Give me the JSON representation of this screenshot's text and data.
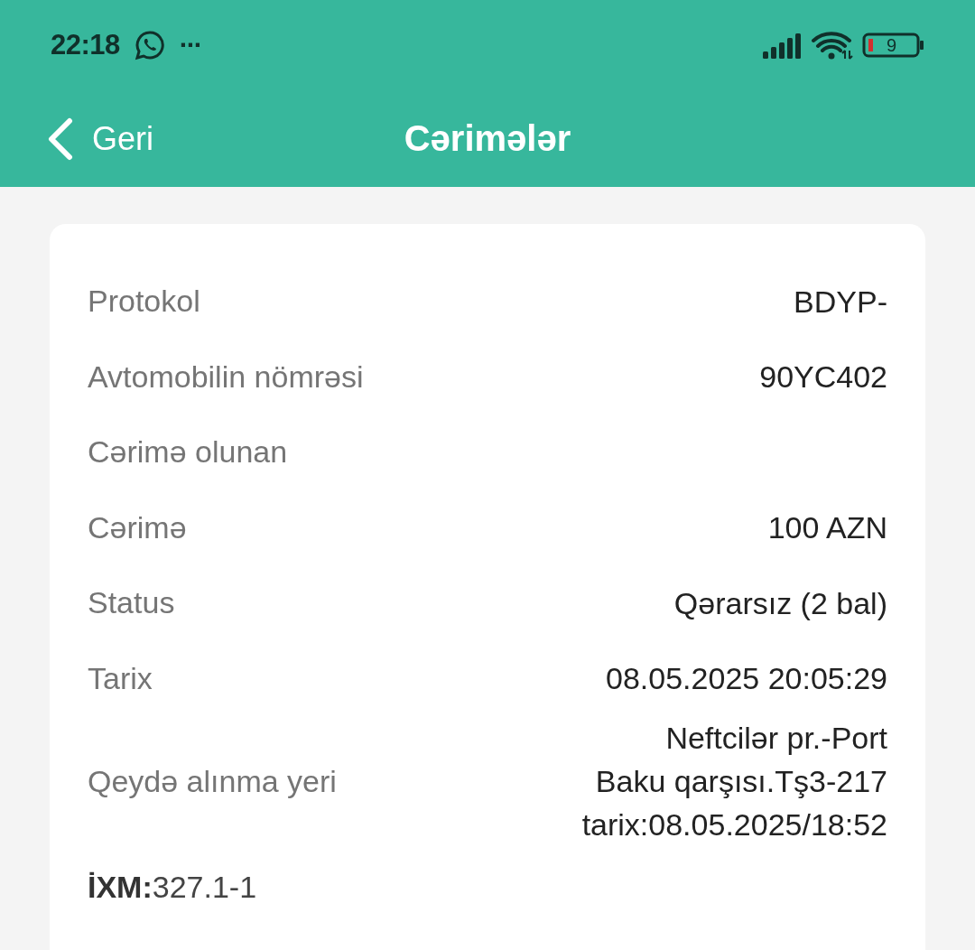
{
  "status_bar": {
    "time": "22:18",
    "more": "···",
    "battery": "9"
  },
  "header": {
    "back": "Geri",
    "title": "Cərimələr"
  },
  "details": [
    {
      "label": "Protokol",
      "value": [
        "BDYP-"
      ]
    },
    {
      "label": "Avtomobilin nömrəsi",
      "value": [
        "90YC402"
      ]
    },
    {
      "label": "Cərimə olunan"
    },
    {
      "label": "Cərimə",
      "value": [
        "100 AZN"
      ]
    },
    {
      "label": "Status",
      "value": [
        "Qərarsız (2 bal)"
      ]
    },
    {
      "label": "Tarix",
      "value": [
        "08.05.2025 20:05:29"
      ]
    },
    {
      "label": "Qeydə alınma yeri",
      "value": [
        "Neftcilər pr.-Port",
        "Baku qarşısı.Tş3-217",
        "tarix:08.05.2025/18:52"
      ]
    }
  ],
  "article": "**İXM:**327.1-1"
}
